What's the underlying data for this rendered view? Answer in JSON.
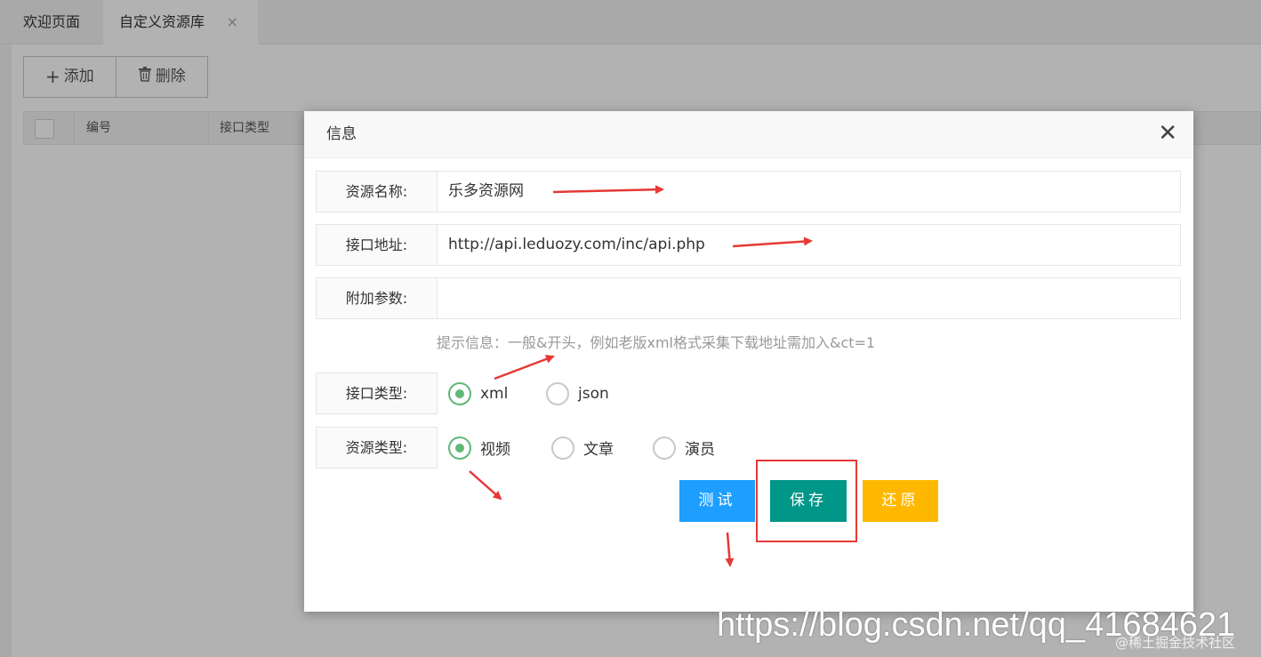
{
  "tabs": [
    {
      "label": "欢迎页面"
    },
    {
      "label": "自定义资源库",
      "close": "×"
    }
  ],
  "toolbar": {
    "add_label": "添加",
    "add_icon": "+",
    "delete_label": "删除",
    "delete_icon": "🗑"
  },
  "table": {
    "columns": [
      "编号",
      "接口类型"
    ]
  },
  "modal": {
    "title": "信息",
    "close": "✕",
    "fields": {
      "name": {
        "label": "资源名称:",
        "value": "乐多资源网"
      },
      "api": {
        "label": "接口地址:",
        "value": "http://api.leduozy.com/inc/api.php"
      },
      "params": {
        "label": "附加参数:",
        "value": ""
      }
    },
    "hint": "提示信息：一般&开头，例如老版xml格式采集下载地址需加入&ct=1",
    "api_type": {
      "label": "接口类型:",
      "options": [
        {
          "label": "xml",
          "checked": true
        },
        {
          "label": "json",
          "checked": false
        }
      ]
    },
    "resource_type": {
      "label": "资源类型:",
      "options": [
        {
          "label": "视频",
          "checked": true
        },
        {
          "label": "文章",
          "checked": false
        },
        {
          "label": "演员",
          "checked": false
        }
      ]
    },
    "buttons": {
      "test": "测试",
      "save": "保存",
      "reset": "还原"
    }
  },
  "watermark": {
    "url": "https://blog.csdn.net/qq_41684621",
    "community": "@稀土掘金技术社区"
  },
  "colors": {
    "primary_blue": "#1e9fff",
    "save_green": "#009688",
    "reset_yellow": "#ffb800",
    "radio_green": "#5fb878",
    "annotation_red": "#e53935"
  }
}
